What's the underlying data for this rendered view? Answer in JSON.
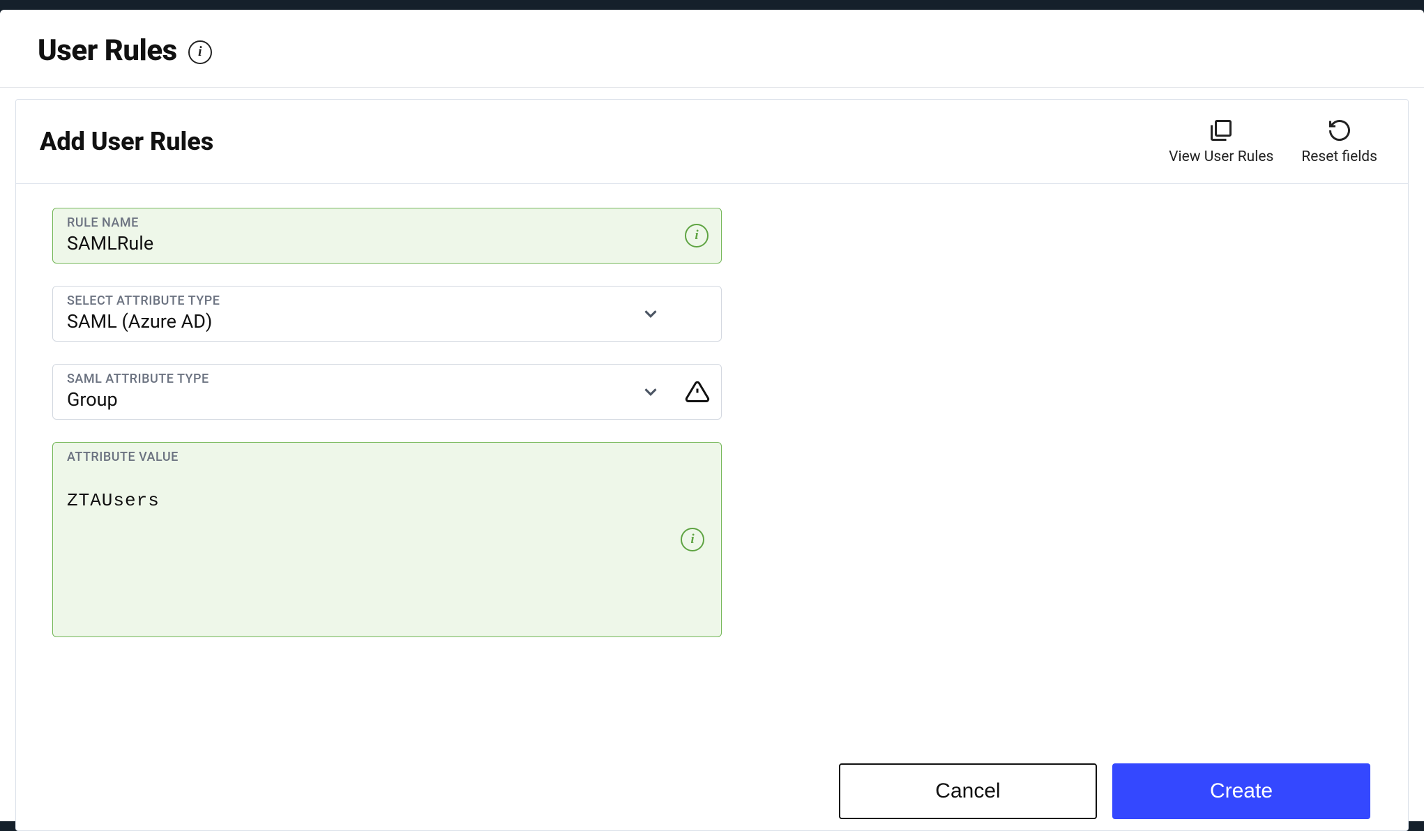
{
  "page": {
    "title": "User Rules"
  },
  "card": {
    "title": "Add User Rules",
    "actions": {
      "view": "View User Rules",
      "reset": "Reset fields"
    }
  },
  "form": {
    "rule_name": {
      "label": "RULE NAME",
      "value": "SAMLRule"
    },
    "attribute_type": {
      "label": "SELECT ATTRIBUTE TYPE",
      "value": "SAML (Azure AD)"
    },
    "saml_attribute_type": {
      "label": "SAML ATTRIBUTE TYPE",
      "value": "Group"
    },
    "attribute_value": {
      "label": "ATTRIBUTE VALUE",
      "value": "ZTAUsers"
    }
  },
  "footer": {
    "cancel": "Cancel",
    "create": "Create"
  }
}
